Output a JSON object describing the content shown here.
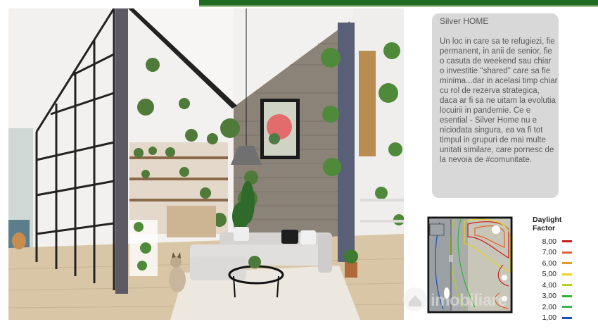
{
  "header": {
    "bar_color": "#1f6b1f"
  },
  "panel": {
    "title": "Silver HOME",
    "body": "Un loc in care sa te refugiezi, fie permanent, in anii de senior, fie o casuta de weekend sau chiar o investitie \"shared\" care sa fie minima...dar in acelasi timp chiar cu rol de rezerva strategica, daca ar fi sa ne uitam la evolutia locuirii in pandemie. Ce e esential - Silver Home nu e niciodata singura, ea va fi tot timpul in grupuri de mai multe unitati similare, care pornesc de la nevoia de #comunitate."
  },
  "legend": {
    "title": "Daylight Factor",
    "items": [
      {
        "value": "8,00",
        "color": "#c81e1e"
      },
      {
        "value": "7,00",
        "color": "#e0642a"
      },
      {
        "value": "6,00",
        "color": "#e8962e"
      },
      {
        "value": "5,00",
        "color": "#e8d21e"
      },
      {
        "value": "4,00",
        "color": "#b4d21e"
      },
      {
        "value": "3,00",
        "color": "#32b432"
      },
      {
        "value": "2,00",
        "color": "#3cb45a"
      },
      {
        "value": "1,00",
        "color": "#1e4eb4"
      }
    ]
  },
  "watermark": {
    "text": "imobiliare"
  },
  "icons": [
    "watermark-logo-icon"
  ]
}
